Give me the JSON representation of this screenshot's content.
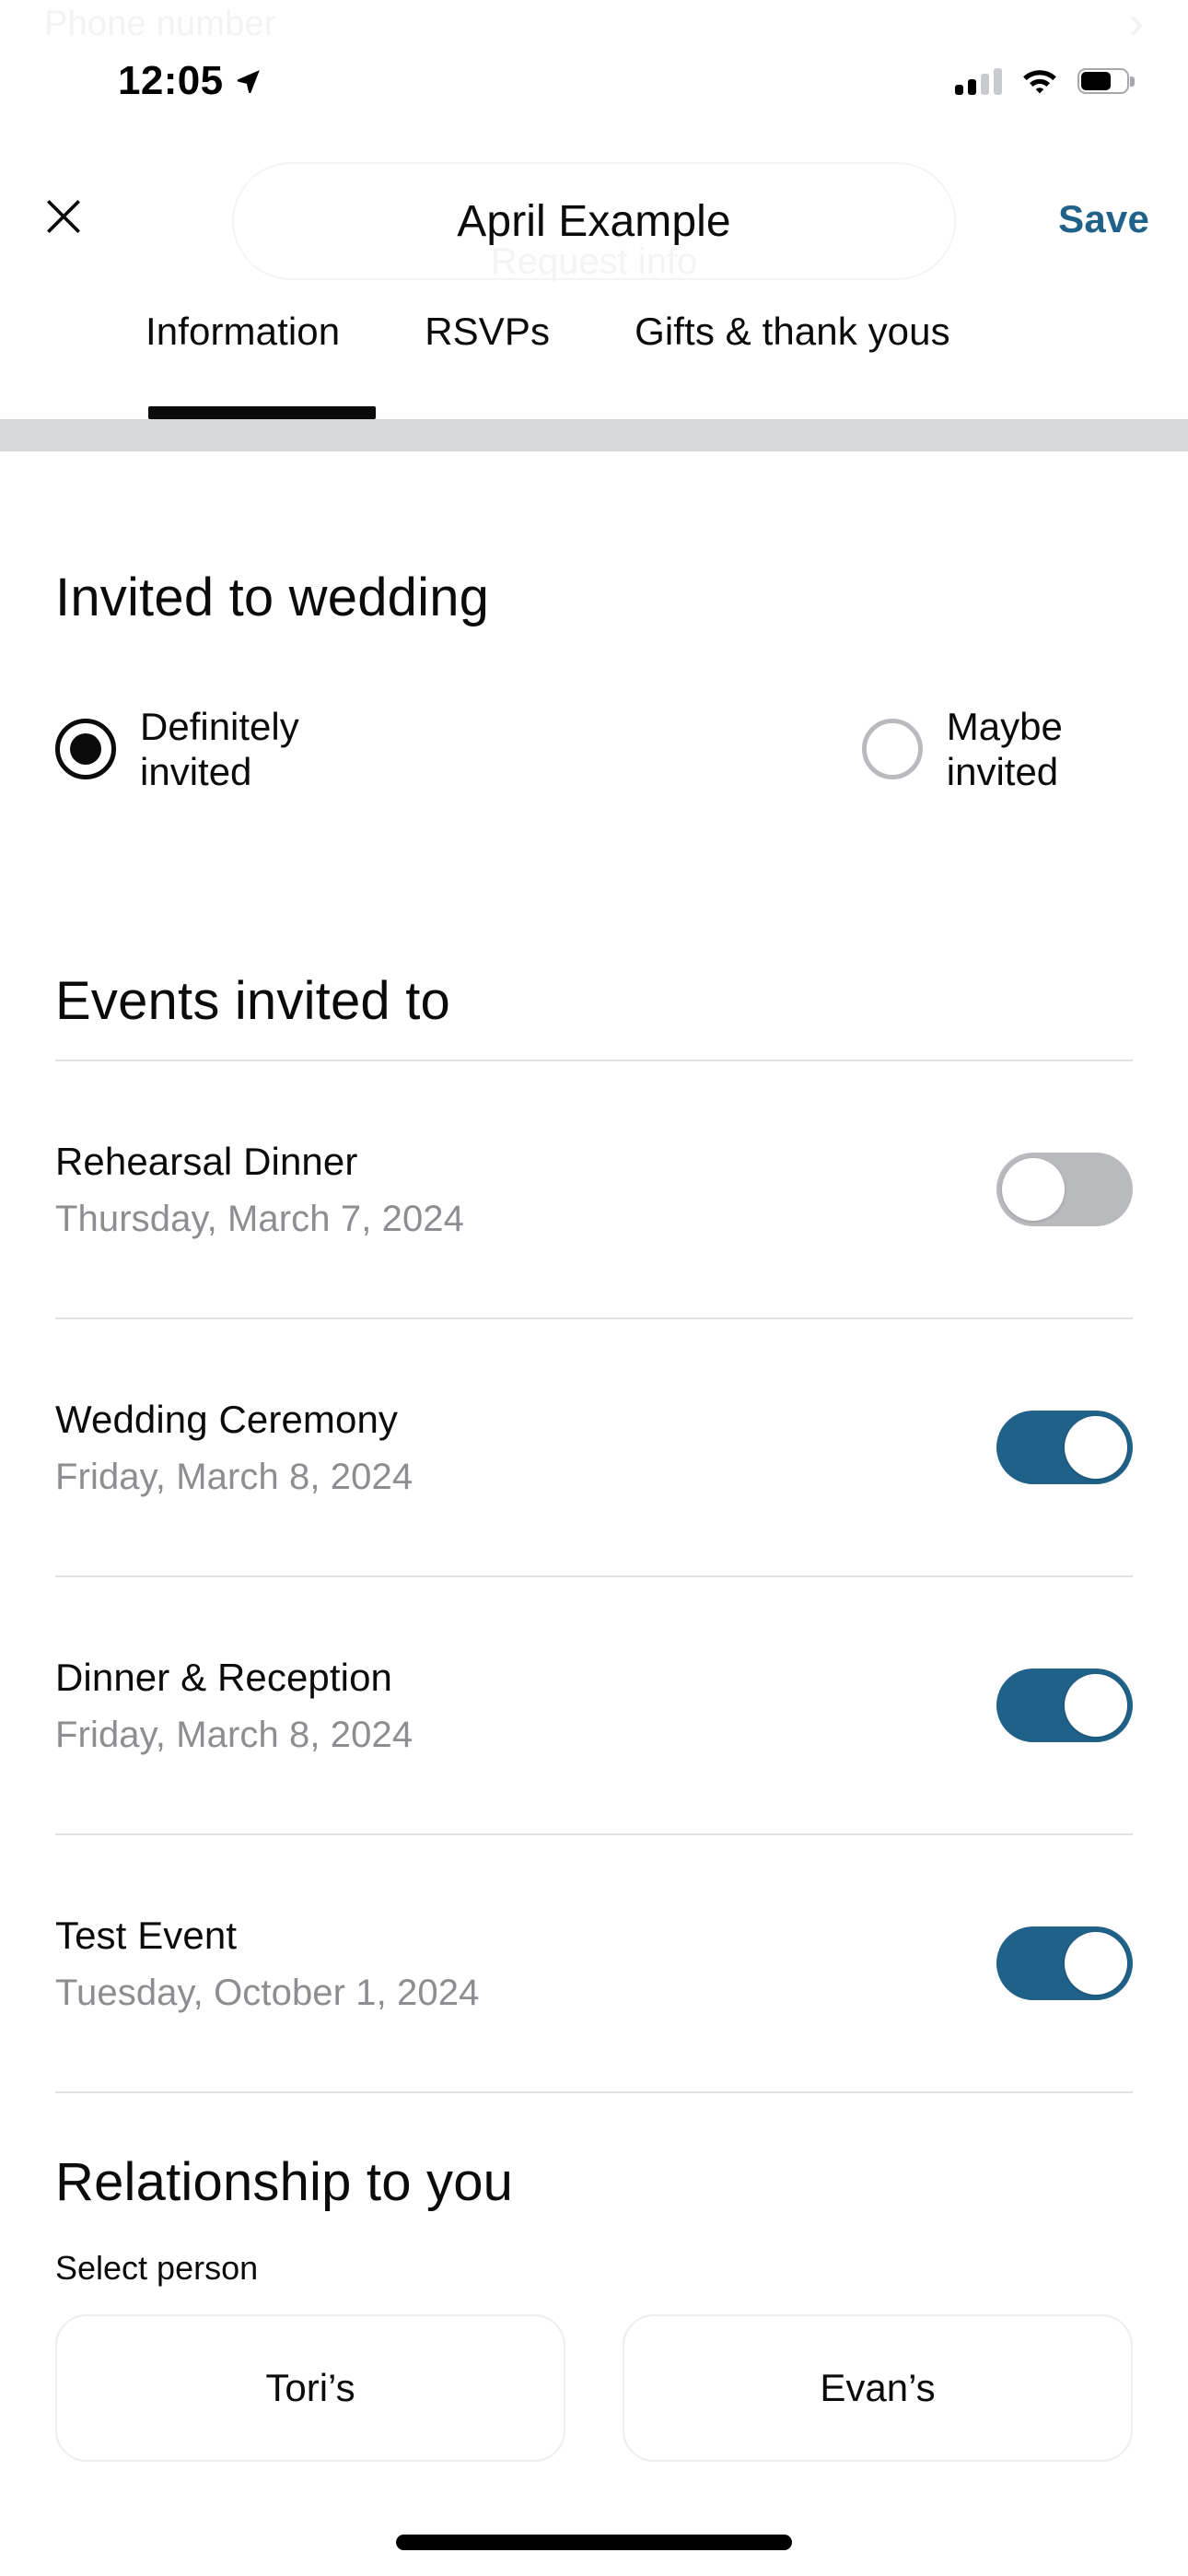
{
  "ghost_row": {
    "label": "Phone number",
    "chevron_icon": "chevron-right-icon"
  },
  "status_bar": {
    "time": "12:05",
    "location_icon": "location-arrow-icon",
    "signal_icon": "cellular-signal-icon",
    "signal_bars_filled": 2,
    "signal_bars_total": 4,
    "wifi_icon": "wifi-icon",
    "battery_icon": "battery-icon",
    "battery_level_percent": 70
  },
  "navbar": {
    "close_icon": "close-x-icon",
    "title": "April Example",
    "ghost_subtitle": "Request info",
    "save_label": "Save",
    "save_color": "#1f6188"
  },
  "tabs": {
    "items": [
      {
        "label": "Information",
        "active": true
      },
      {
        "label": "RSVPs",
        "active": false
      },
      {
        "label": "Gifts & thank yous",
        "active": false
      }
    ],
    "indicator_color": "#0b0b0b",
    "divider_color": "#d7d8da"
  },
  "invited_to_wedding": {
    "heading": "Invited to wedding",
    "options": [
      {
        "label_line1": "Definitely",
        "label_line2": "invited",
        "selected": true
      },
      {
        "label_line1": "Maybe",
        "label_line2": "invited",
        "selected": false
      }
    ]
  },
  "events_invited_to": {
    "heading": "Events invited to",
    "events": [
      {
        "name": "Rehearsal Dinner",
        "date": "Thursday, March 7, 2024",
        "enabled": false
      },
      {
        "name": "Wedding Ceremony",
        "date": "Friday, March 8, 2024",
        "enabled": true
      },
      {
        "name": "Dinner & Reception",
        "date": "Friday, March 8, 2024",
        "enabled": true
      },
      {
        "name": "Test Event",
        "date": "Tuesday, October 1, 2024",
        "enabled": true
      }
    ],
    "toggle_on_color": "#1f6188",
    "toggle_off_color": "#b9babd"
  },
  "relationship": {
    "heading": "Relationship to you",
    "select_label": "Select person",
    "people": [
      {
        "label": "Tori’s"
      },
      {
        "label": "Evan’s"
      }
    ]
  },
  "home_indicator": {
    "icon": "home-indicator"
  }
}
